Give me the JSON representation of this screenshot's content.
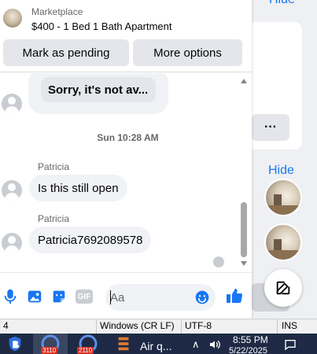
{
  "background": {
    "hide_label_top": "Hide",
    "hide_label": "Hide",
    "more_label": "···"
  },
  "listing": {
    "kicker": "Marketplace",
    "title": "$400 - 1 Bed 1 Bath Apartment",
    "mark_pending_label": "Mark as pending",
    "more_options_label": "More options"
  },
  "messages": {
    "previous_preview": "Sorry, it's not av...",
    "timestamp": "Sun 10:28 AM",
    "items": [
      {
        "sender": "Patricia",
        "text": "Is this still open"
      },
      {
        "sender": "Patricia",
        "text": "Patricia7692089578"
      }
    ]
  },
  "composer": {
    "placeholder": "Aa",
    "icons": [
      "microphone-icon",
      "photo-icon",
      "sticker-icon",
      "gif-icon",
      "emoji-icon",
      "thumbs-up-icon"
    ],
    "gif_text": "GIF"
  },
  "statusbar": {
    "col": "4",
    "line_ending": "Windows (CR LF)",
    "encoding": "UTF-8",
    "mode": "INS"
  },
  "taskbar": {
    "app_label": "Air q...",
    "badge_1": "3110",
    "badge_2": "2110",
    "time": "8:55 PM",
    "date": "5/22/2025"
  },
  "colors": {
    "accent": "#1877f2",
    "taskbar": "#1e2a45"
  }
}
